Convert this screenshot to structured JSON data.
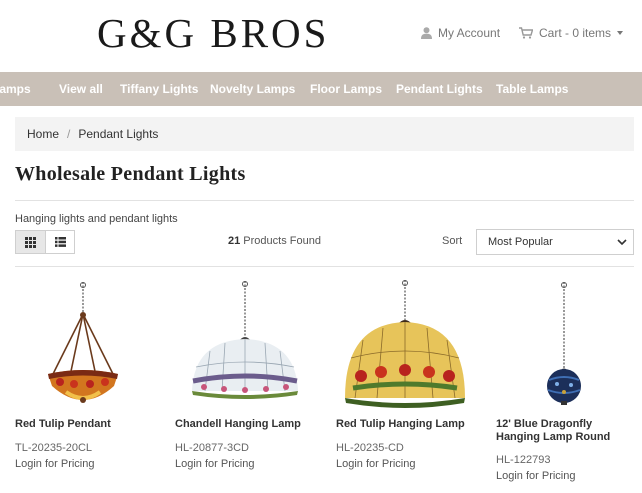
{
  "header": {
    "logo_text": "G&G BROS",
    "account_label": "My Account",
    "cart_label": "Cart - 0 items"
  },
  "nav": {
    "items": [
      {
        "label": "Lamps"
      },
      {
        "label": "View all"
      },
      {
        "label": "Tiffany Lights"
      },
      {
        "label": "Novelty Lamps"
      },
      {
        "label": "Floor Lamps"
      },
      {
        "label": "Pendant Lights"
      },
      {
        "label": "Table Lamps"
      }
    ]
  },
  "breadcrumb": {
    "home": "Home",
    "separator": "/",
    "current": "Pendant Lights"
  },
  "page": {
    "title": "Wholesale Pendant Lights",
    "description": "Hanging lights and pendant lights"
  },
  "toolbar": {
    "count_number": "21",
    "count_text": " Products Found",
    "sort_label": "Sort",
    "sort_value": "Most Popular"
  },
  "products": [
    {
      "name": "Red Tulip Pendant",
      "sku": "TL-20235-20CL",
      "price": "Login for Pricing"
    },
    {
      "name": "Chandell Hanging Lamp",
      "sku": "HL-20877-3CD",
      "price": "Login for Pricing"
    },
    {
      "name": "Red Tulip Hanging Lamp",
      "sku": "HL-20235-CD",
      "price": "Login for Pricing"
    },
    {
      "name": "12' Blue Dragonfly Hanging Lamp Round",
      "sku": "HL-122793",
      "price": "Login for Pricing"
    }
  ],
  "colors": {
    "nav_bg": "#c9c0b7",
    "nav_text": "#ffffff",
    "breadcrumb_bg": "#f3f3f3",
    "heading": "#222222"
  },
  "icons": {
    "account": "user-icon",
    "cart": "cart-icon",
    "grid_view": "grid-view-icon",
    "list_view": "list-view-icon",
    "sort_caret": "chevron-down-icon"
  }
}
